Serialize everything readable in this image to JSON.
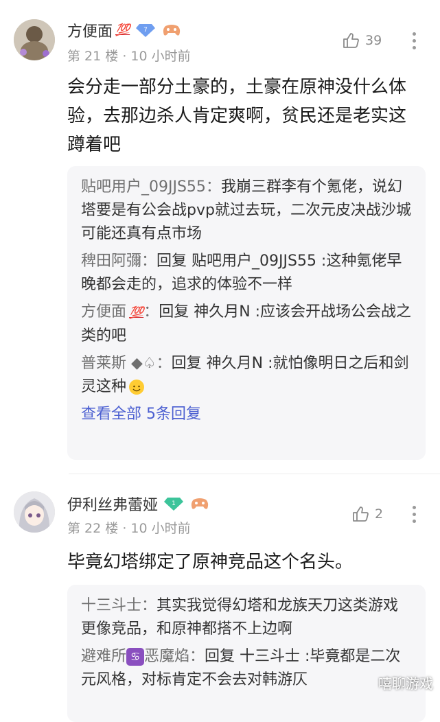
{
  "posts": [
    {
      "username": "方便面",
      "emoji_badge": "💯",
      "level_badge": "7",
      "floor": "第 21 楼",
      "time": "10 小时前",
      "likes": "39",
      "content": "会分走一部分土豪的，土豪在原神没什么体验，去那边杀人肯定爽啊，贫民还是老实这蹲着吧",
      "replies": [
        {
          "name": "贴吧用户_09JJS55：",
          "text": "我崩三群李有个氪佬，说幻塔要是有公会战pvp就过去玩，二次元皮决战沙城可能还真有点市场"
        },
        {
          "name": "稗田阿彌：",
          "text": "回复 贴吧用户_09JJS55 :这种氪佬早晚都会走的，追求的体验不一样"
        },
        {
          "name": "方便面",
          "name_badge": "💯",
          "name_suffix": "：",
          "text": "回复 神久月N :应该会开战场公会战之类的吧"
        },
        {
          "name": "普莱斯 ◆♤：",
          "text": "回复 神久月N :就怕像明日之后和剑灵这种"
        }
      ],
      "more_replies": "查看全部 5条回复"
    },
    {
      "username": "伊利丝弗蕾娅",
      "level_badge": "1",
      "floor": "第 22 楼",
      "time": "10 小时前",
      "likes": "2",
      "content": "毕竟幻塔绑定了原神竞品这个名头。",
      "replies": [
        {
          "name": "十三斗士：",
          "text": "其实我觉得幻塔和龙族天刀这类游戏更像竞品，和原神都搭不上边啊"
        },
        {
          "name_prefix": "避难所",
          "name_mid": "♋",
          "name": "恶魔焰：",
          "text": "回复 十三斗士 :毕竟都是二次元风格，对标肯定不会去对韩游仄"
        }
      ]
    }
  ],
  "watermark": "嘻聊游戏",
  "colors": {
    "link": "#4b5fd1",
    "reply_bg": "#f6f6f8",
    "hundred": "#d0242c"
  }
}
